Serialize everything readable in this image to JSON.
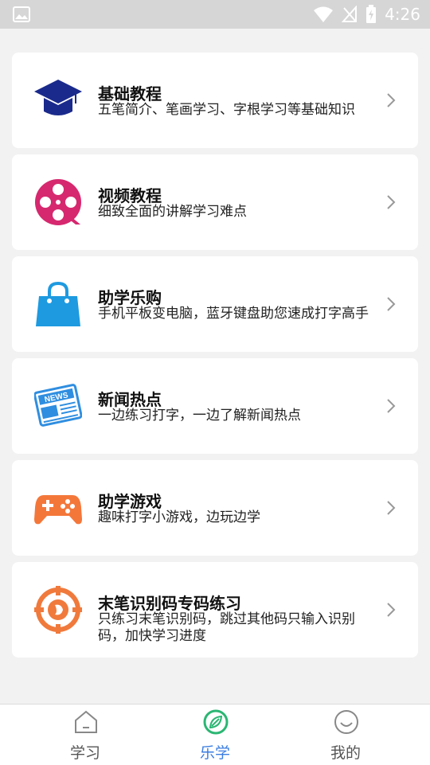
{
  "status_bar": {
    "time": "4:26"
  },
  "cards": [
    {
      "title": "基础教程",
      "desc": "五笔简介、笔画学习、字根学习等基础知识",
      "icon": "graduation-cap-icon"
    },
    {
      "title": "视频教程",
      "desc": "细致全面的讲解学习难点",
      "icon": "film-reel-icon"
    },
    {
      "title": "助学乐购",
      "desc": "手机平板变电脑，蓝牙键盘助您速成打字高手",
      "icon": "shopping-bag-icon"
    },
    {
      "title": "新闻热点",
      "desc": "一边练习打字，一边了解新闻热点",
      "icon": "newspaper-icon",
      "icon_text": "NEWS"
    },
    {
      "title": "助学游戏",
      "desc": "趣味打字小游戏，边玩边学",
      "icon": "gamepad-icon"
    },
    {
      "title": "末笔识别码专码练习",
      "desc": "只练习末笔识别码，跳过其他码只输入识别码，加快学习进度",
      "icon": "target-icon"
    }
  ],
  "bottom_nav": [
    {
      "label": "学习",
      "icon": "home-icon",
      "active": false
    },
    {
      "label": "乐学",
      "icon": "compass-leaf-icon",
      "active": true
    },
    {
      "label": "我的",
      "icon": "smiley-icon",
      "active": false
    }
  ],
  "colors": {
    "accent": "#3a7de0",
    "active_icon": "#2bb673",
    "cap": "#1a2a8c",
    "film": "#d6286e",
    "bag": "#1e9ae0",
    "news": "#2f8ee0",
    "gamepad": "#f4773a",
    "target": "#f07a3c"
  }
}
